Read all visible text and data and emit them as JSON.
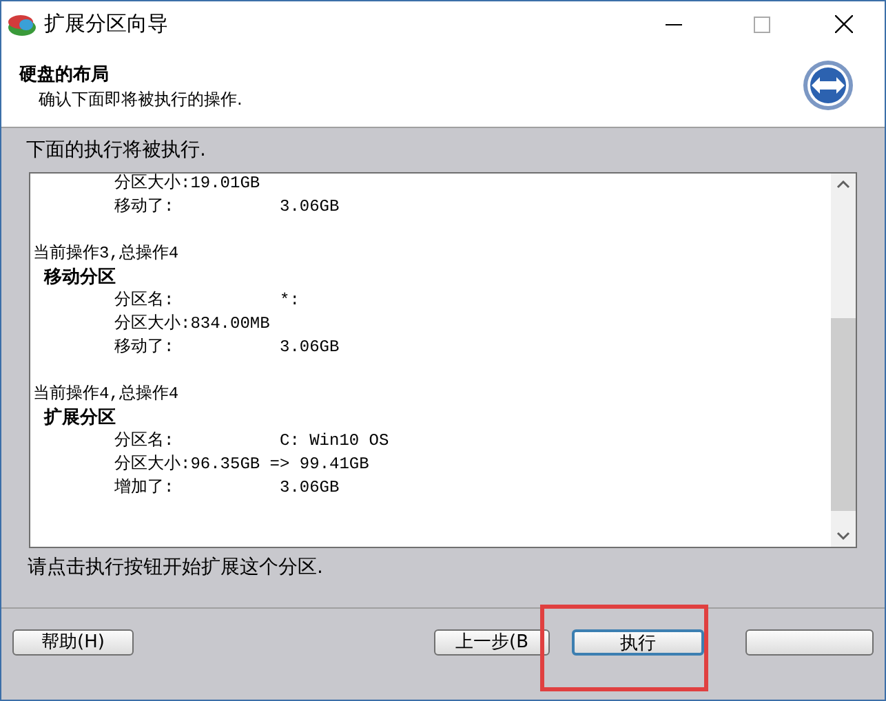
{
  "window": {
    "title": "扩展分区向导"
  },
  "header": {
    "title": "硬盘的布局",
    "subtitle": "确认下面即将被执行的操作."
  },
  "list_label": "下面的执行将被执行.",
  "log": [
    {
      "kind": "line",
      "text": "分区大小:19.01GB"
    },
    {
      "kind": "pair",
      "label": "移动了:",
      "value": "3.06GB"
    },
    {
      "kind": "blank"
    },
    {
      "kind": "step",
      "text": "当前操作3,总操作4"
    },
    {
      "kind": "operation",
      "text": "移动分区"
    },
    {
      "kind": "pair",
      "label": "分区名:",
      "value": "*:"
    },
    {
      "kind": "line",
      "text": "分区大小:834.00MB"
    },
    {
      "kind": "pair",
      "label": "移动了:",
      "value": "3.06GB"
    },
    {
      "kind": "blank"
    },
    {
      "kind": "step",
      "text": "当前操作4,总操作4"
    },
    {
      "kind": "operation",
      "text": "扩展分区"
    },
    {
      "kind": "pair",
      "label": "分区名:",
      "value": "C: Win10 OS"
    },
    {
      "kind": "line",
      "text": "分区大小:96.35GB => 99.41GB"
    },
    {
      "kind": "pair",
      "label": "增加了:",
      "value": "3.06GB"
    }
  ],
  "hint": "请点击执行按钮开始扩展这个分区.",
  "buttons": [
    {
      "label": "帮助(H)",
      "default": false
    },
    {
      "label": "上一步(B",
      "default": false
    },
    {
      "label": "执行",
      "default": true
    },
    {
      "default": false
    }
  ]
}
